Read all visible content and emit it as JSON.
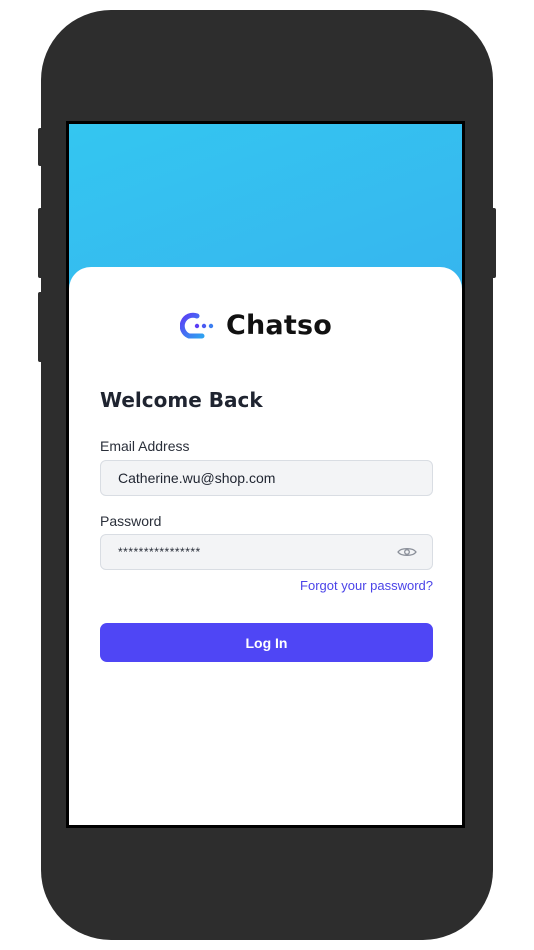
{
  "brand": {
    "name": "Chatso",
    "accent_color": "#4f46f5",
    "gradient_top": "#34c6f0",
    "gradient_bottom": "#3b98ec"
  },
  "login": {
    "title": "Welcome Back",
    "email_label": "Email Address",
    "email_value": "Catherine.wu@shop.com",
    "password_label": "Password",
    "password_value": "****************",
    "password_toggle_icon": "eye-icon",
    "forgot_link": "Forgot your password?",
    "submit_label": "Log In"
  }
}
